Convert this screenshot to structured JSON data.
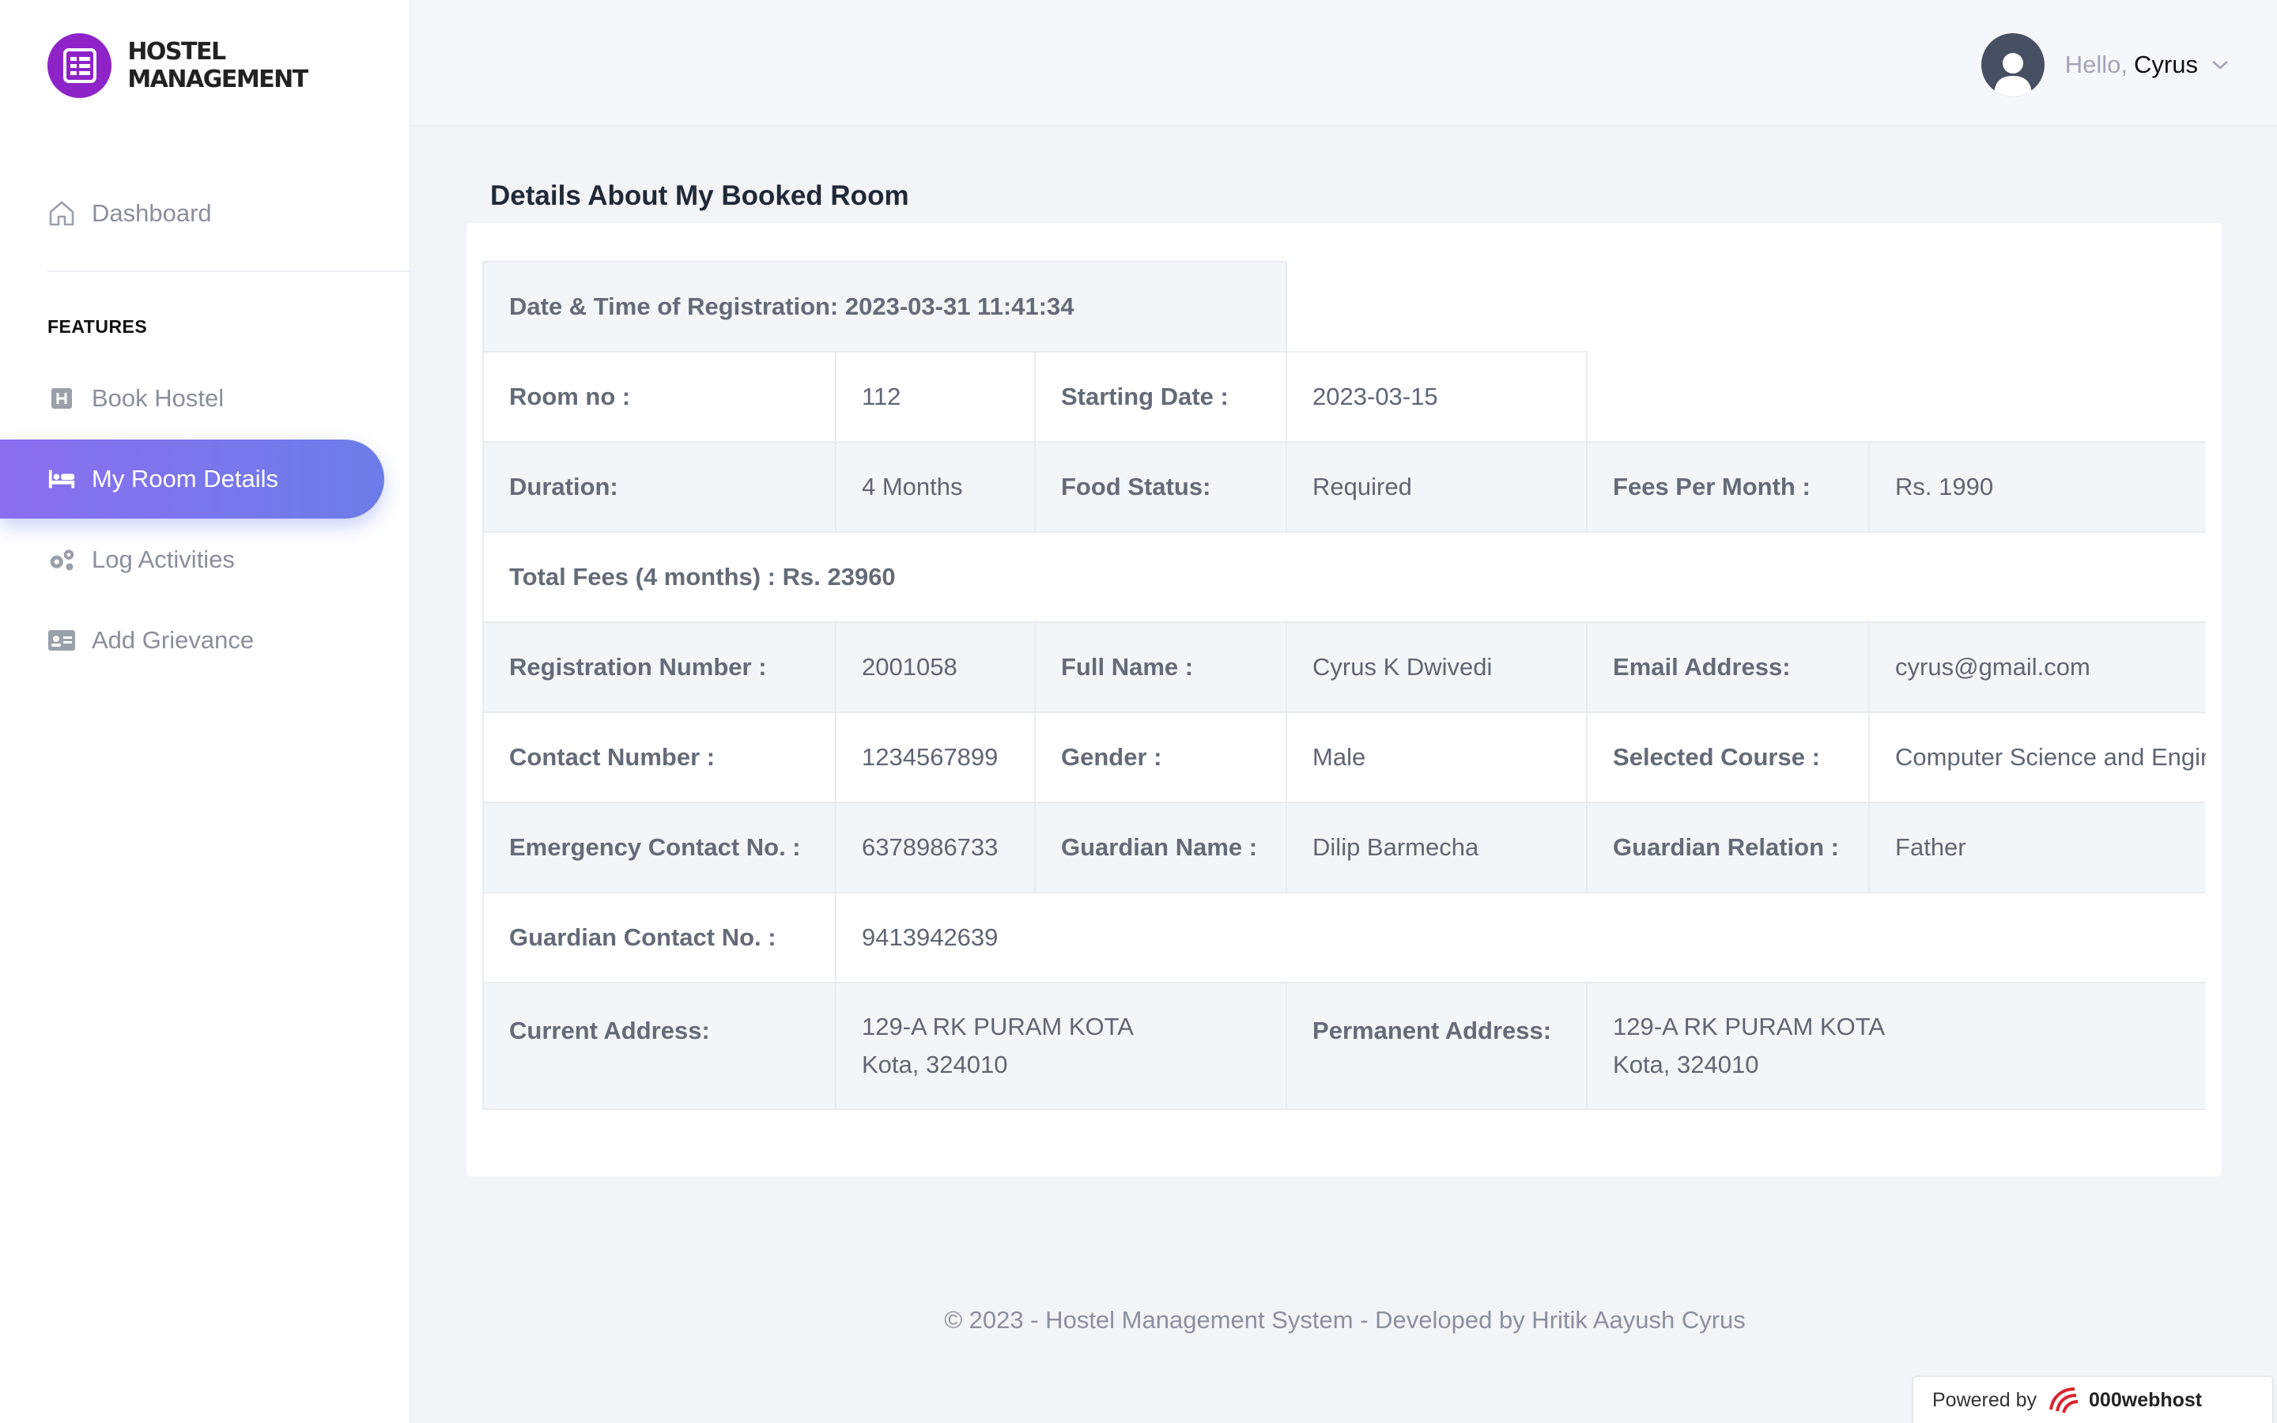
{
  "brand": {
    "name": "HOSTEL MANAGEMENT",
    "logo_color": "#8e24c8"
  },
  "sidebar": {
    "dashboard": "Dashboard",
    "section_title": "FEATURES",
    "items": [
      {
        "label": "Book Hostel",
        "icon": "hotel-icon"
      },
      {
        "label": "My Room Details",
        "icon": "bed-icon",
        "active": true
      },
      {
        "label": "Log Activities",
        "icon": "gears-icon"
      },
      {
        "label": "Add Grievance",
        "icon": "id-card-icon"
      }
    ]
  },
  "header": {
    "greeting": "Hello,",
    "username": "Cyrus"
  },
  "main": {
    "title": "Details About My Booked Room",
    "registration": "Date & Time of Registration: 2023-03-31 11:41:34",
    "room_no_label": "Room no :",
    "room_no": "112",
    "starting_date_label": "Starting Date :",
    "starting_date": "2023-03-15",
    "duration_label": "Duration:",
    "duration": "4 Months",
    "food_status_label": "Food Status:",
    "food_status": "Required",
    "fees_label": "Fees Per Month :",
    "fees": "Rs. 1990",
    "total_fees": "Total Fees (4 months) : Rs. 23960",
    "reg_no_label": "Registration Number :",
    "reg_no": "2001058",
    "full_name_label": "Full Name :",
    "full_name": "Cyrus K Dwivedi",
    "email_label": "Email Address:",
    "email": "cyrus@gmail.com",
    "contact_label": "Contact Number :",
    "contact": "1234567899",
    "gender_label": "Gender :",
    "gender": "Male",
    "course_label": "Selected Course :",
    "course": "Computer Science and Engineering",
    "emergency_label": "Emergency Contact No. :",
    "emergency": "6378986733",
    "guardian_name_label": "Guardian Name :",
    "guardian_name": "Dilip Barmecha",
    "guardian_relation_label": "Guardian Relation :",
    "guardian_relation": "Father",
    "guardian_contact_label": "Guardian Contact No. :",
    "guardian_contact": "9413942639",
    "current_address_label": "Current Address:",
    "current_address_line1": "129-A RK PURAM KOTA",
    "current_address_line2": "Kota, 324010",
    "permanent_address_label": "Permanent Address:",
    "permanent_address_line1": "129-A RK PURAM KOTA",
    "permanent_address_line2": "Kota, 324010"
  },
  "footer": {
    "copyright": "© 2023 - Hostel Management System - Developed by Hritik Aayush Cyrus",
    "powered_by": "Powered by",
    "host": "000webhost"
  },
  "colors": {
    "accent_start": "#8a6ef0",
    "accent_end": "#6c7de8"
  }
}
